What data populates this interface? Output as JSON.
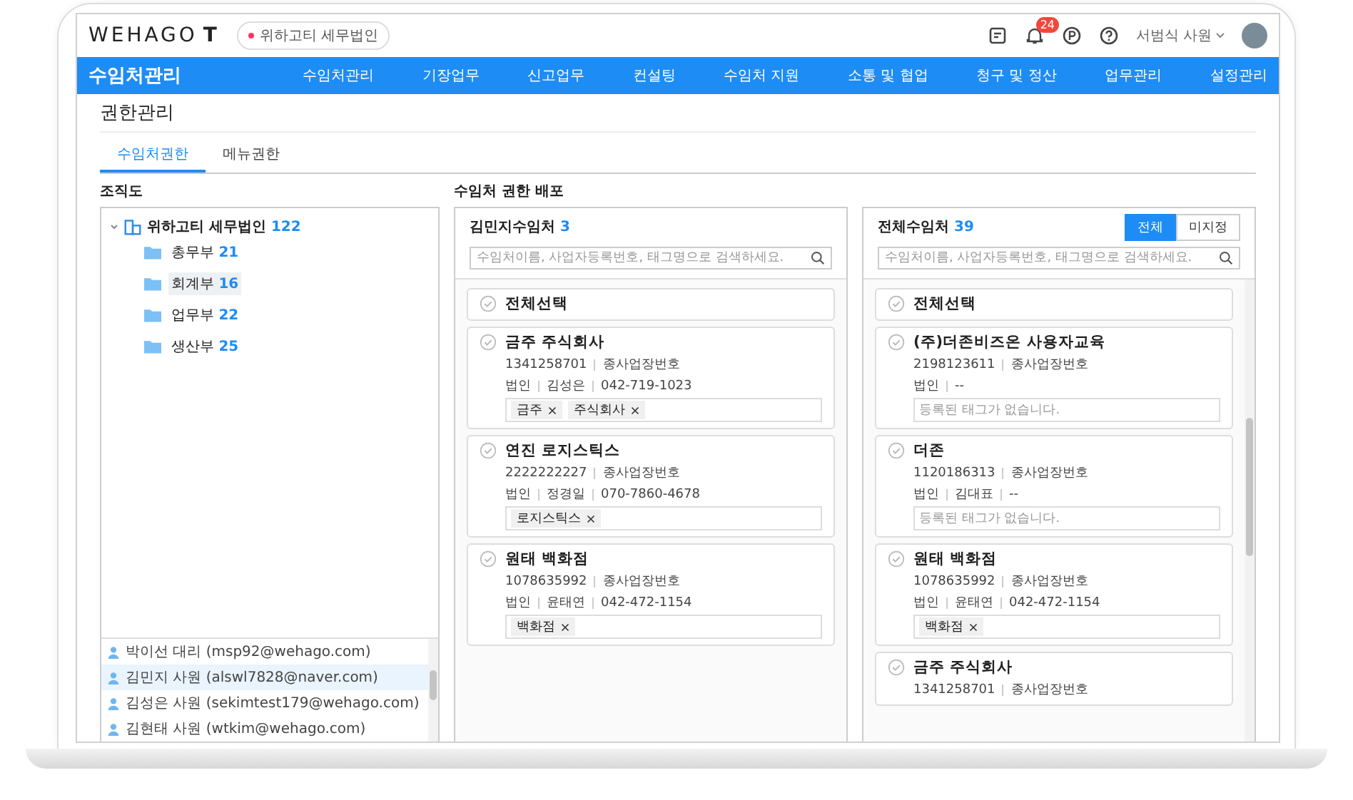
{
  "header": {
    "logo": "WEHAGO",
    "logo_suffix": "T",
    "company": "위하고티 세무법인",
    "notification_count": "24",
    "user": "서범식 사원"
  },
  "nav": {
    "title": "수임처관리",
    "items": [
      "수임처관리",
      "기장업무",
      "신고업무",
      "컨설팅",
      "수임처 지원",
      "소통 및 협업",
      "청구 및 정산",
      "업무관리",
      "설정관리"
    ]
  },
  "page_title": "권한관리",
  "tabs": [
    {
      "label": "수임처권한",
      "selected": true
    },
    {
      "label": "메뉴권한",
      "selected": false
    }
  ],
  "org": {
    "title": "조직도",
    "root": {
      "label": "위하고티 세무법인",
      "count": "122",
      "expanded": true,
      "children": [
        {
          "label": "총무부",
          "count": "21",
          "selected": false
        },
        {
          "label": "회계부",
          "count": "16",
          "selected": true
        },
        {
          "label": "업무부",
          "count": "22",
          "selected": false
        },
        {
          "label": "생산부",
          "count": "25",
          "selected": false
        }
      ]
    },
    "users": [
      {
        "name": "박이선 대리 (msp92@wehago.com)",
        "selected": false
      },
      {
        "name": "김민지 사원 (alswl7828@naver.com)",
        "selected": true
      },
      {
        "name": "김성은 사원 (sekimtest179@wehago.com)",
        "selected": false
      },
      {
        "name": "김현태 사원 (wtkim@wehago.com)",
        "selected": false
      }
    ]
  },
  "distribution": {
    "title": "수임처 권한 배포",
    "panels": [
      {
        "title": "김민지수임처",
        "count": "3",
        "search_placeholder": "수임처이름, 사업자등록번호, 태그명으로 검색하세요.",
        "select_all": {
          "label": "전체선택",
          "checked": false
        },
        "clients": [
          {
            "name": "금주 주식회사",
            "bizno": "1341258701",
            "branch": "종사업장번호",
            "type": "법인",
            "rep": "김성은",
            "phone": "042-719-1023",
            "tags": [
              "금주",
              "주식회사"
            ],
            "checked": false
          },
          {
            "name": "연진 로지스틱스",
            "bizno": "2222222227",
            "branch": "종사업장번호",
            "type": "법인",
            "rep": "정경일",
            "phone": "070-7860-4678",
            "tags": [
              "로지스틱스"
            ],
            "checked": false
          },
          {
            "name": "원태 백화점",
            "bizno": "1078635992",
            "branch": "종사업장번호",
            "type": "법인",
            "rep": "윤태연",
            "phone": "042-472-1154",
            "tags": [
              "백화점"
            ],
            "checked": false
          }
        ]
      },
      {
        "title": "전체수임처",
        "count": "39",
        "filters": [
          {
            "label": "전체",
            "selected": true
          },
          {
            "label": "미지정",
            "selected": false
          }
        ],
        "search_placeholder": "수임처이름, 사업자등록번호, 태그명으로 검색하세요.",
        "select_all": {
          "label": "전체선택",
          "checked": false
        },
        "clients": [
          {
            "name": "(주)더존비즈온 사용자교육",
            "bizno": "2198123611",
            "branch": "종사업장번호",
            "type": "법인",
            "phone": "--",
            "empty_tags": "등록된 태그가 없습니다.",
            "checked": false
          },
          {
            "name": "더존",
            "bizno": "1120186313",
            "branch": "종사업장번호",
            "type": "법인",
            "rep": "김대표",
            "phone": "--",
            "empty_tags": "등록된 태그가 없습니다.",
            "checked": false
          },
          {
            "name": "원태 백화점",
            "bizno": "1078635992",
            "branch": "종사업장번호",
            "type": "법인",
            "rep": "윤태연",
            "phone": "042-472-1154",
            "tags": [
              "백화점"
            ],
            "checked": false
          },
          {
            "name": "금주 주식회사",
            "bizno": "1341258701",
            "branch": "종사업장번호",
            "checked": false
          }
        ]
      }
    ]
  }
}
